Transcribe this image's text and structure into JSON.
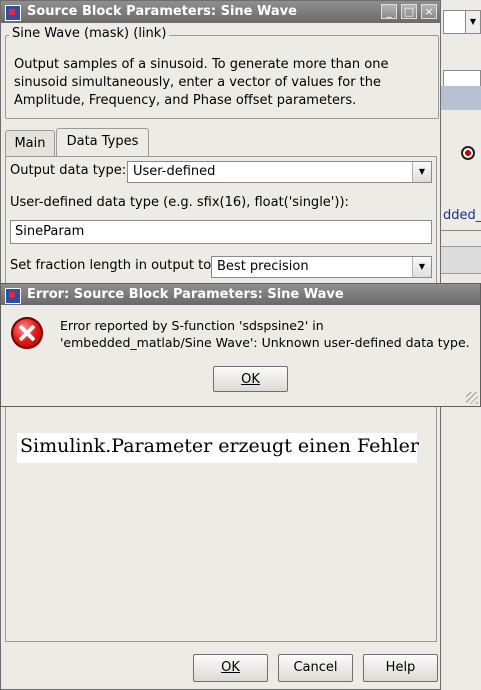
{
  "background_window": {
    "link_text": "dded_",
    "icon": "target-icon"
  },
  "dialog": {
    "title": "Source Block Parameters: Sine Wave",
    "window_controls": {
      "minimize": "_",
      "maximize": "□",
      "close": "×"
    },
    "mask_group_title": "Sine Wave (mask) (link)",
    "description": "Output samples of a sinusoid.  To generate more than one sinusoid simultaneously, enter a vector of values for the Amplitude, Frequency, and Phase offset parameters.",
    "tabs": [
      {
        "label": "Main",
        "active": false
      },
      {
        "label": "Data Types",
        "active": true
      }
    ],
    "output_data_type": {
      "label": "Output data type:",
      "value": "User-defined"
    },
    "user_defined": {
      "label": "User-defined data type (e.g. sfix(16), float('single')):",
      "value": "SineParam"
    },
    "fraction_length": {
      "label": "Set fraction length in output to:",
      "value": "Best precision"
    },
    "annotation": "Simulink.Parameter erzeugt einen Fehler",
    "buttons": {
      "ok": "OK",
      "cancel": "Cancel",
      "help": "Help"
    }
  },
  "error_dialog": {
    "title": "Error: Source Block Parameters: Sine Wave",
    "message": "Error reported by S-function 'sdspsine2' in 'embedded_matlab/Sine Wave': Unknown user-defined data type.",
    "ok_label": "OK",
    "icon": "error-icon"
  }
}
